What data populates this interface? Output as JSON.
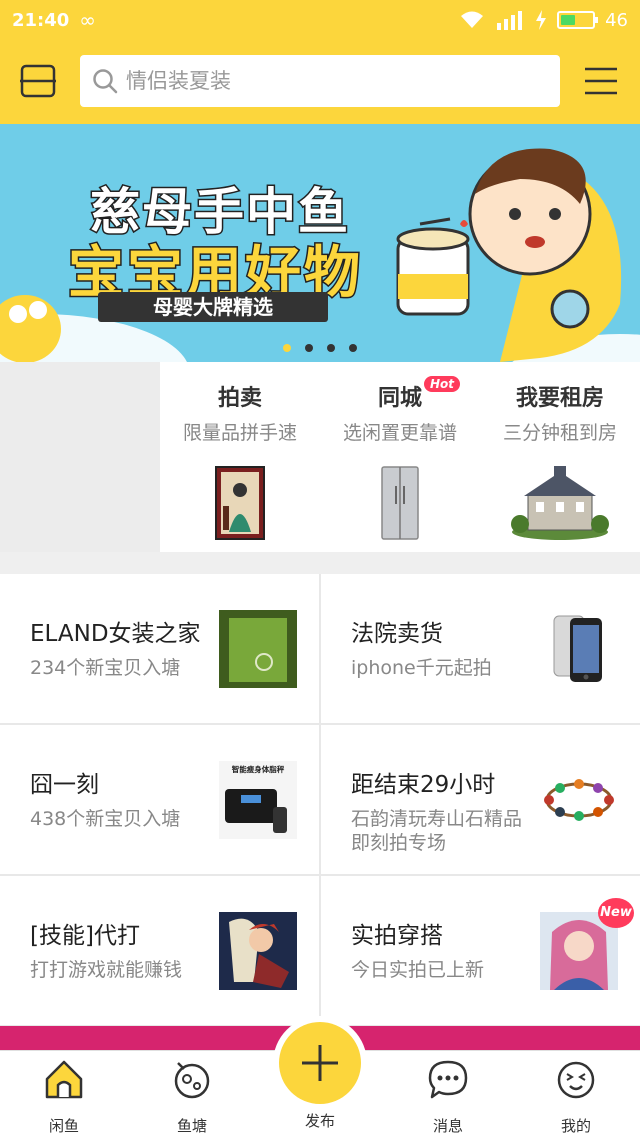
{
  "status_bar": {
    "time": "21:40",
    "battery": "46",
    "battery_level": 0.46
  },
  "header": {
    "search_placeholder": "情侣装夏装"
  },
  "banner": {
    "title_line1": "慈母手中鱼",
    "title_line2": "宝宝用好物",
    "tagline": "母婴大牌精选",
    "dot_count": 4,
    "active_dot": 0
  },
  "features": [
    {
      "title": "拍卖",
      "subtitle": "限量品拼手速",
      "badge": ""
    },
    {
      "title": "同城",
      "subtitle": "选闲置更靠谱",
      "badge": "Hot"
    },
    {
      "title": "我要租房",
      "subtitle": "三分钟租到房",
      "badge": ""
    }
  ],
  "cards": [
    {
      "title": "ELAND女装之家",
      "subtitle": "234个新宝贝入塘"
    },
    {
      "title": "法院卖货",
      "subtitle": "iphone千元起拍"
    },
    {
      "title": "囧一刻",
      "subtitle": "438个新宝贝入塘",
      "thumb_text": "智能瘦身体脂秤"
    },
    {
      "title": "距结束29小时",
      "subtitle": "石韵清玩寿山石精品即刻拍专场"
    },
    {
      "title": "[技能]代打",
      "subtitle": "打打游戏就能赚钱"
    },
    {
      "title": "实拍穿搭",
      "subtitle": "今日实拍已上新",
      "badge": "New"
    }
  ],
  "tabbar": {
    "home": "闲鱼",
    "pond": "鱼塘",
    "publish": "发布",
    "messages": "消息",
    "mine": "我的"
  },
  "colors": {
    "brand_yellow": "#fcd63c",
    "hot_red": "#ff3b5c",
    "banner_blue": "#6fcde8"
  }
}
